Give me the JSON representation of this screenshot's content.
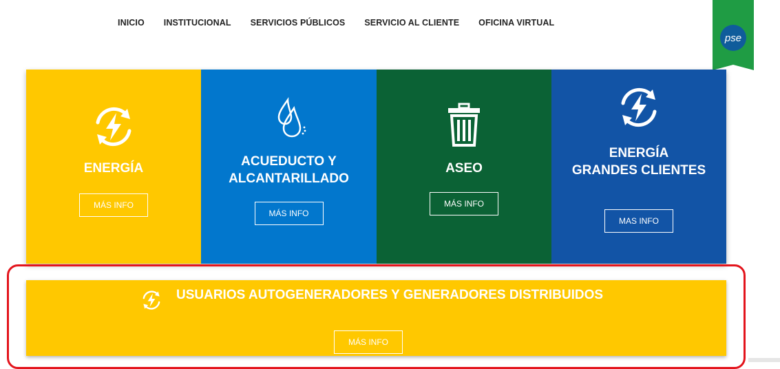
{
  "nav": [
    "INICIO",
    "INSTITUCIONAL",
    "SERVICIOS PÚBLICOS",
    "SERVICIO AL CLIENTE",
    "OFICINA VIRTUAL"
  ],
  "pse_logo": "pse",
  "cards": [
    {
      "title": "ENERGÍA",
      "button": "MÁS INFO",
      "color": "#ffc800",
      "icon": "energy-cycle-icon"
    },
    {
      "title_line1": "ACUEDUCTO Y",
      "title_line2": "ALCANTARILLADO",
      "button": "MÁS INFO",
      "color": "#0277cd",
      "icon": "water-drops-icon"
    },
    {
      "title": "ASEO",
      "button": "MÁS INFO",
      "color": "#0b6235",
      "icon": "trash-can-icon"
    },
    {
      "title_line1": "ENERGÍA",
      "title_line2": "GRANDES CLIENTES",
      "button": "MAS INFO",
      "color": "#1254a6",
      "icon": "energy-cycle-icon"
    }
  ],
  "banner": {
    "title": "USUARIOS AUTOGENERADORES Y GENERADORES DISTRIBUIDOS",
    "button": "MÁS INFO",
    "color": "#ffc800",
    "icon": "energy-cycle-icon"
  },
  "highlight_color": "#e3141c"
}
